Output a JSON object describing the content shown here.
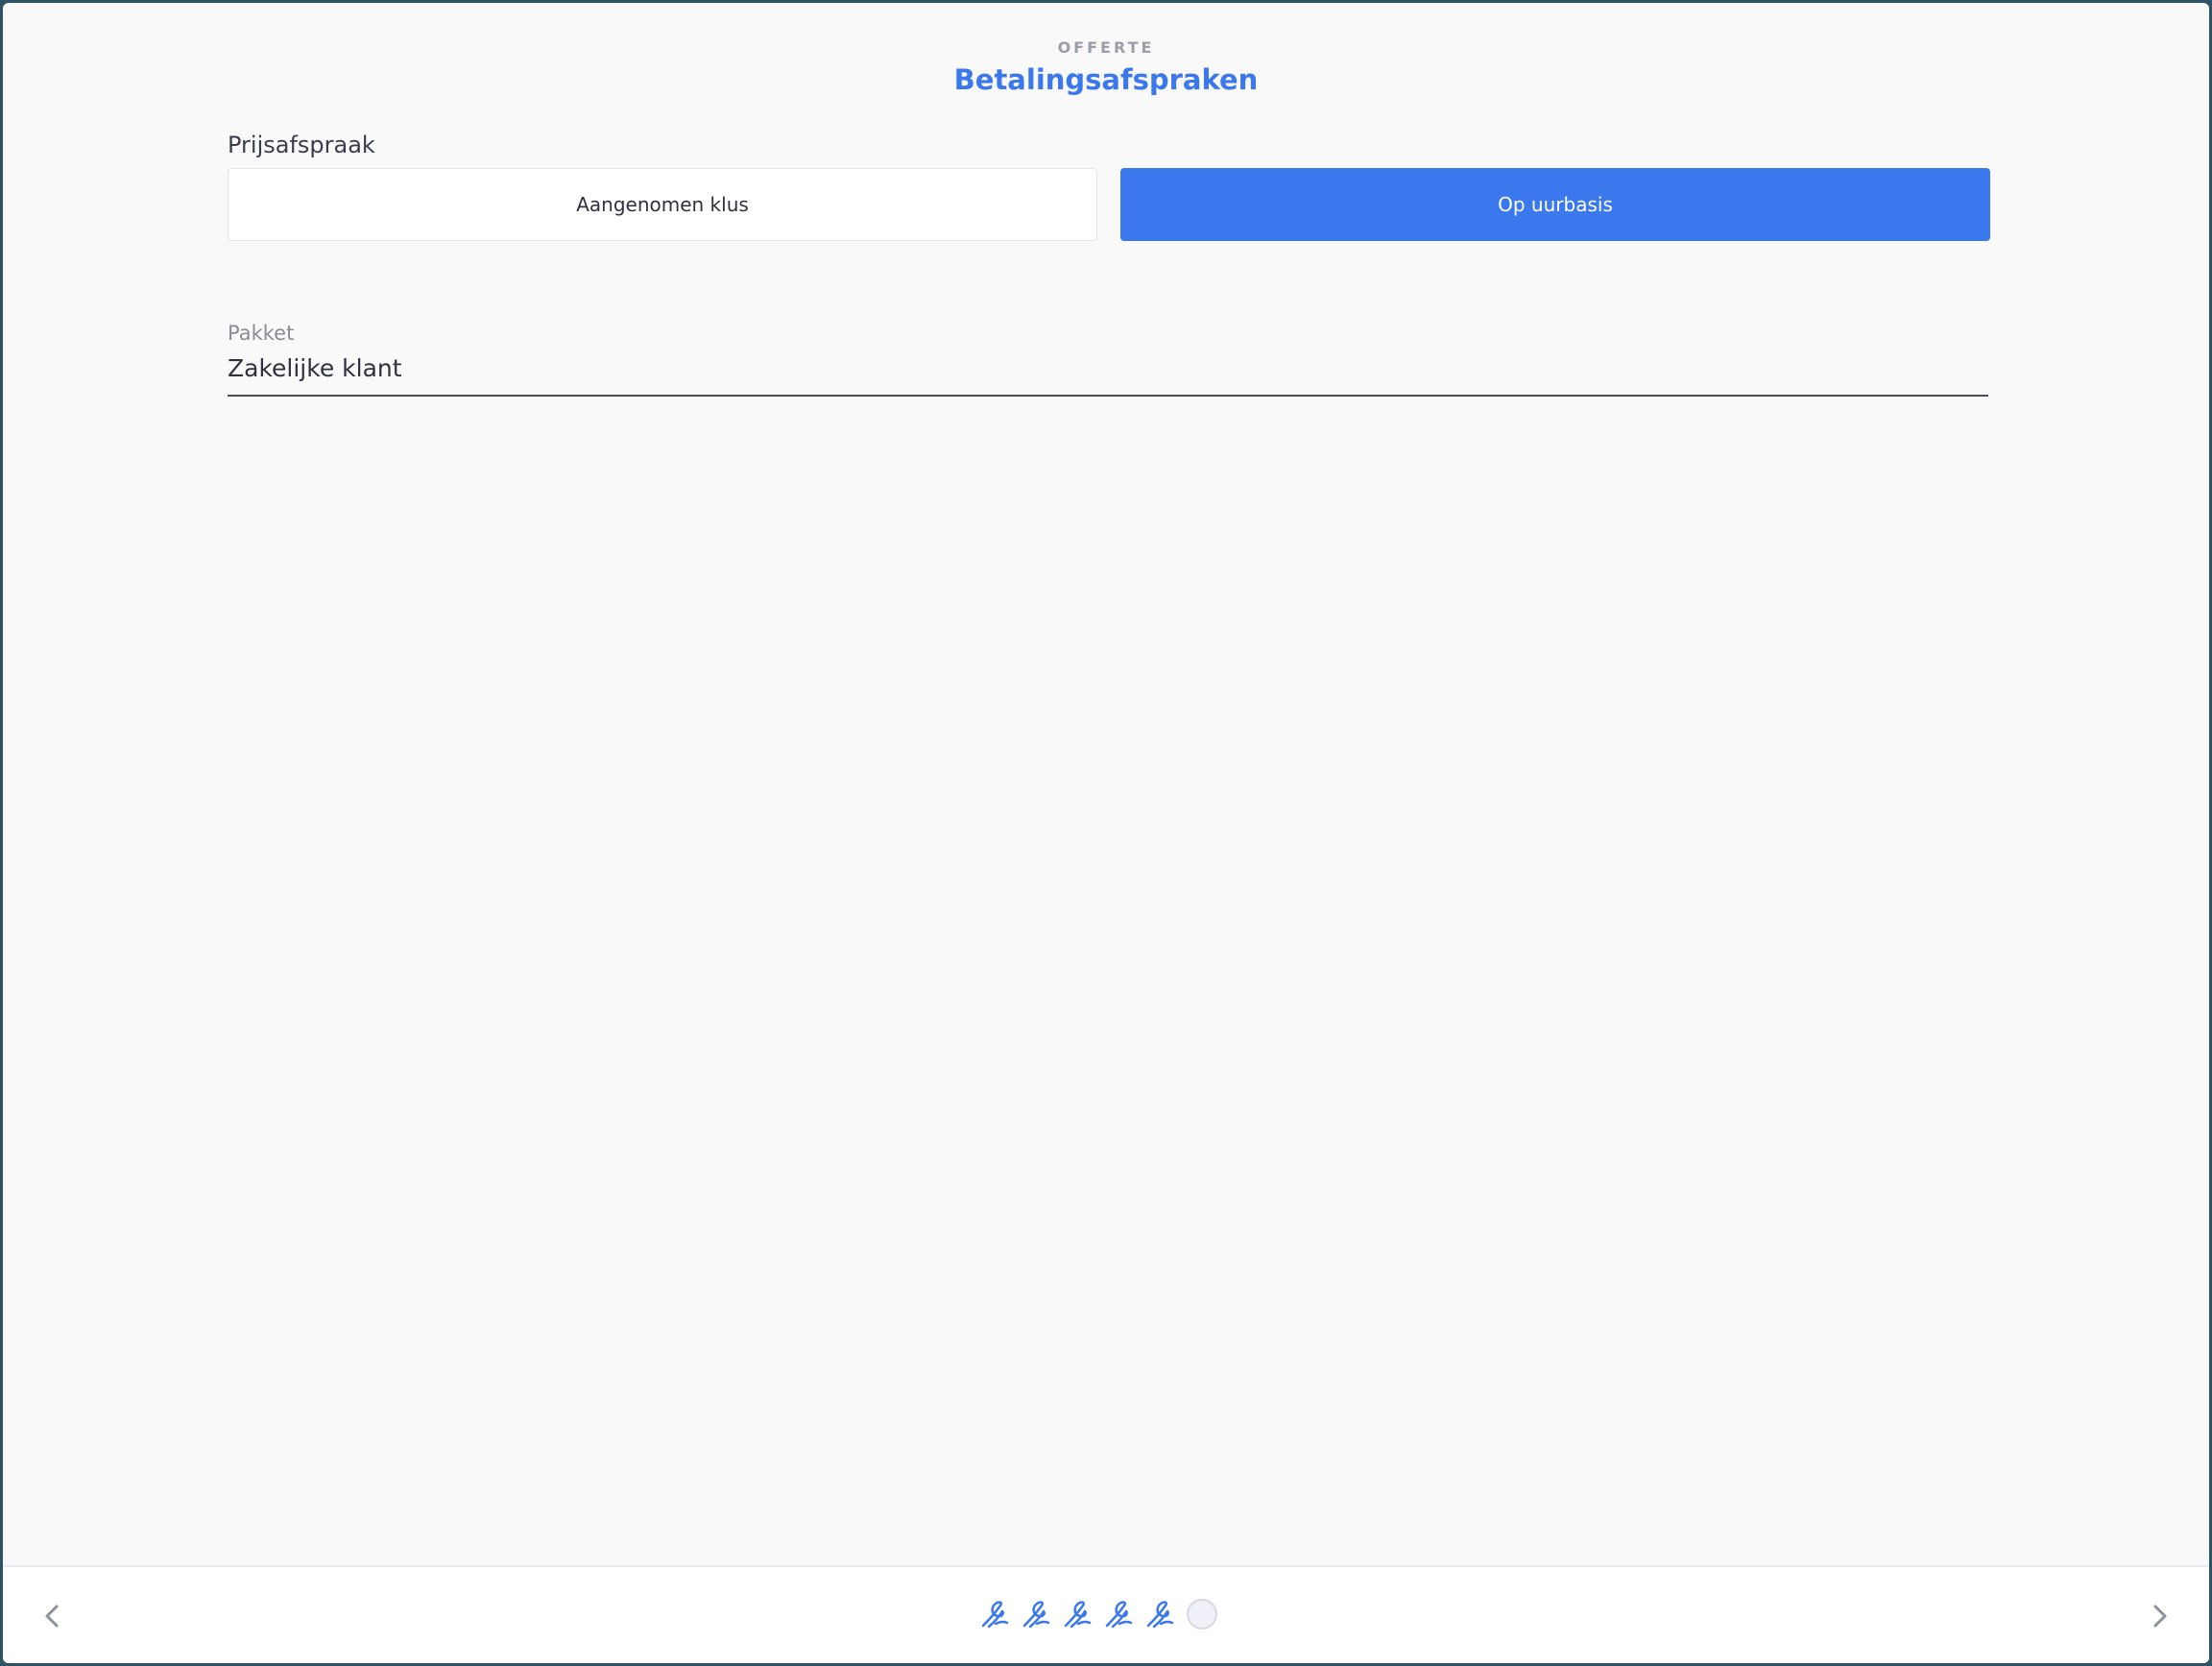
{
  "header": {
    "eyebrow": "OFFERTE",
    "title": "Betalingsafspraken"
  },
  "price_agreement": {
    "label": "Prijsafspraak",
    "options": [
      {
        "label": "Aangenomen klus",
        "selected": false
      },
      {
        "label": "Op uurbasis",
        "selected": true
      }
    ]
  },
  "package": {
    "label": "Pakket",
    "value": "Zakelijke klant"
  },
  "footer": {
    "prev_icon": "chevron-left-icon",
    "next_icon": "chevron-right-icon",
    "steps": [
      {
        "state": "completed",
        "icon": "signature-icon"
      },
      {
        "state": "completed",
        "icon": "signature-icon"
      },
      {
        "state": "completed",
        "icon": "signature-icon"
      },
      {
        "state": "completed",
        "icon": "signature-icon"
      },
      {
        "state": "completed",
        "icon": "signature-icon"
      },
      {
        "state": "current",
        "icon": "empty-circle-icon"
      }
    ]
  },
  "colors": {
    "accent": "#3b78ee",
    "background": "#f9f9f9",
    "frame": "#2c5464",
    "muted_text": "#9a9ea8"
  }
}
